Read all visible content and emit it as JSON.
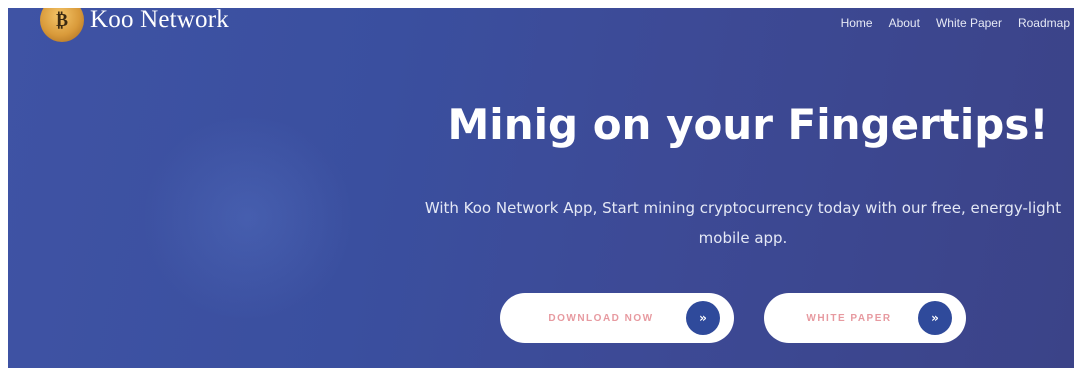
{
  "brand": {
    "name": "Koo Network",
    "logo_glyph": "₿"
  },
  "nav": {
    "items": [
      "Home",
      "About",
      "White Paper",
      "Roadmap"
    ]
  },
  "hero": {
    "headline": "Minig on your Fingertips!",
    "subtext": "With Koo Network App, Start mining cryptocurrency today with our free, energy-light mobile app.",
    "background_color": "#3d4d9c"
  },
  "buttons": {
    "download_label": "DOWNLOAD NOW",
    "whitepaper_label": "WHITE PAPER",
    "arrow_glyph": "»",
    "label_color": "#e79aa0",
    "arrow_bg_color": "#2f4a9b"
  }
}
